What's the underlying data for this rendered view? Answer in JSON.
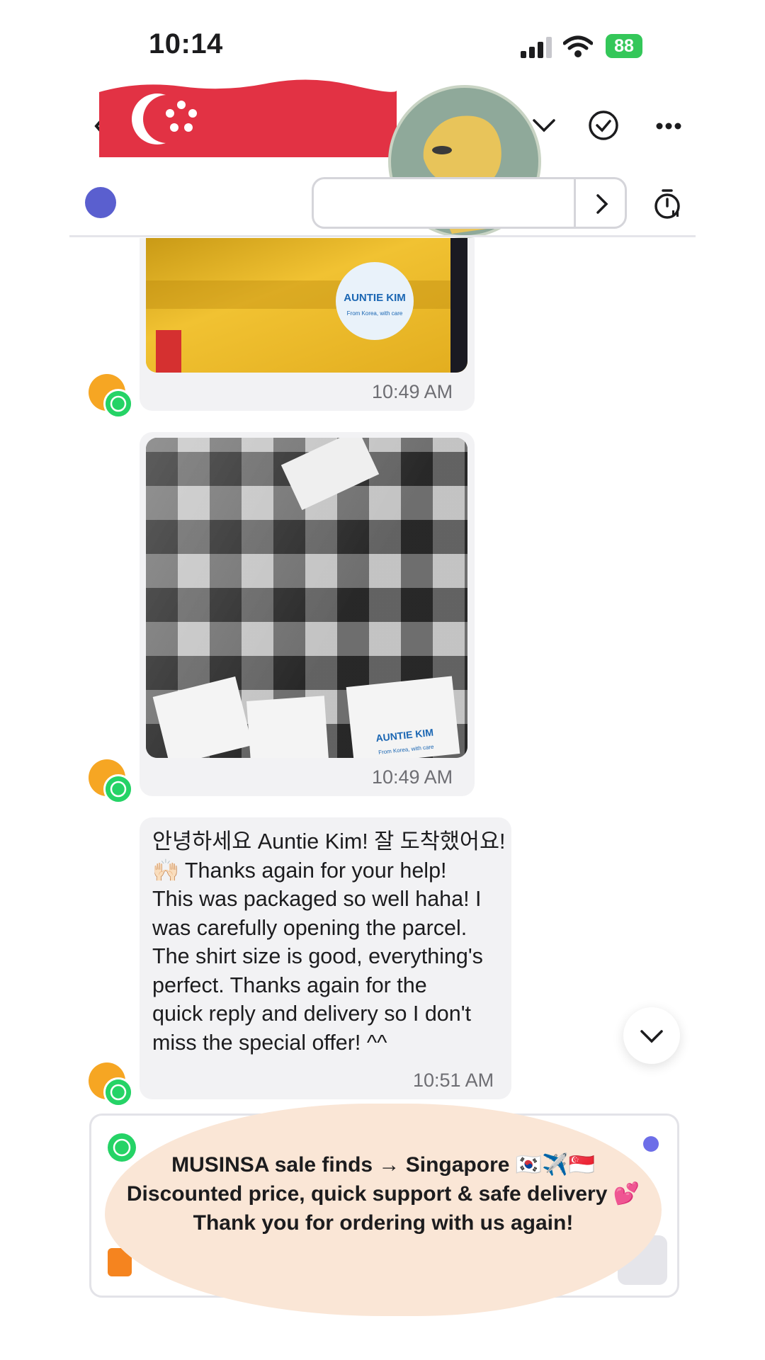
{
  "status_bar": {
    "time": "10:14",
    "battery": "88"
  },
  "messages": [
    {
      "kind": "image",
      "alt": "Parcel photo",
      "sticker_line1": "AUNTIE KIM",
      "sticker_line2": "From Korea, with care",
      "time": "10:49 AM"
    },
    {
      "kind": "image",
      "alt": "Shirt photo",
      "card_line1": "AUNTIE KIM",
      "card_line2": "From Korea, with care",
      "time": "10:49 AM"
    },
    {
      "kind": "text",
      "lines": [
        "안녕하세요 Auntie Kim! 잘 도착했어요!",
        "🙌🏻 Thanks again for your help!",
        "This was packaged so well haha! I",
        "was carefully opening the parcel.",
        "The shirt size is good, everything's",
        "perfect. Thanks again for the",
        "quick reply and delivery so I don't",
        "miss the special offer! ^^"
      ],
      "time": "10:51 AM"
    }
  ],
  "promo": {
    "line1": "MUSINSA sale finds → Singapore 🇰🇷✈️🇸🇬",
    "line2": "Discounted price, quick support & safe delivery 💕",
    "line3": "Thank you for ordering with us again!"
  },
  "colors": {
    "whatsapp": "#25d366",
    "avatar": "#f6a623",
    "flag_red": "#e23244",
    "promo_bg": "#fae6d6",
    "battery": "#34c759"
  },
  "icons": [
    "back-icon",
    "chevron-down-icon",
    "check-circle-icon",
    "more-icon",
    "chevron-right-icon",
    "timer-icon",
    "whatsapp-icon",
    "scroll-down-icon"
  ]
}
